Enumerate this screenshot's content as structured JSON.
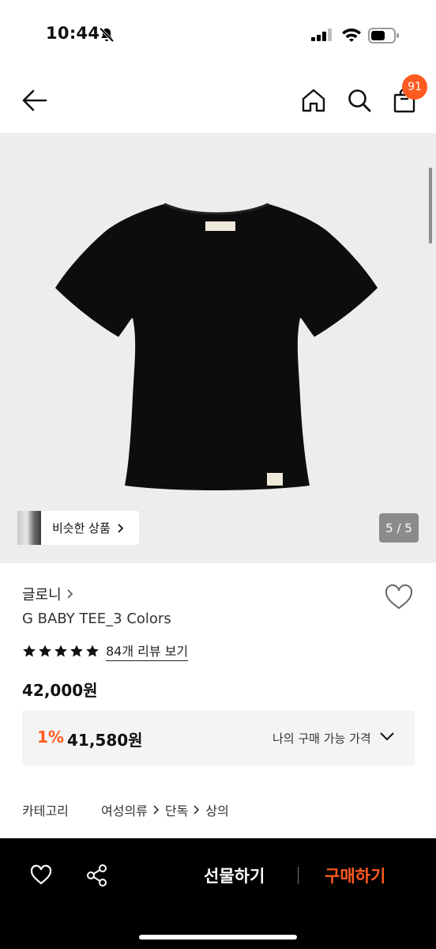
{
  "status": {
    "time": "10:44"
  },
  "header": {
    "cart_count": "91"
  },
  "gallery": {
    "similar_label": "비슷한 상품",
    "page": "5 / 5"
  },
  "product": {
    "brand": "글로니",
    "title": "G BABY TEE_3 Colors",
    "rating_stars": 5,
    "review_link": "84개 리뷰 보기",
    "price": "42,000원",
    "my_price": {
      "rate": "1%",
      "price": "41,580원",
      "label": "나의 구매 가능 가격"
    },
    "category": {
      "label": "카테고리",
      "path": [
        "여성의류",
        "단독",
        "상의"
      ]
    }
  },
  "bottom_bar": {
    "gift_label": "선물하기",
    "buy_label": "구매하기"
  },
  "colors": {
    "accent": "#ff5a1f",
    "bar": "#000000",
    "image_bg": "#ededed"
  },
  "icons": [
    "bell-muted-icon",
    "signal-icon",
    "wifi-icon",
    "battery-icon",
    "back-arrow-icon",
    "home-icon",
    "search-icon",
    "shopping-bag-icon",
    "heart-outline-icon",
    "star-icon",
    "chevron-right-icon",
    "chevron-down-icon",
    "share-icon"
  ]
}
